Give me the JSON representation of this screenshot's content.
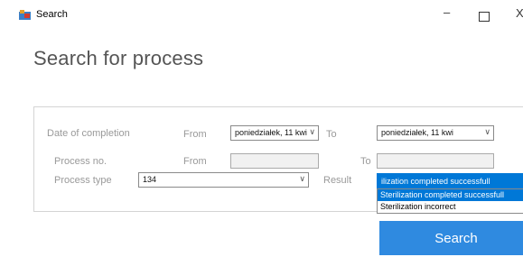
{
  "window": {
    "title": "Search"
  },
  "heading": "Search for process",
  "filters": {
    "date_of_completion_label": "Date of completion",
    "date_from_label": "From",
    "date_from_value": "poniedziałek, 11  kwi",
    "date_to_label": "To",
    "date_to_value": "poniedziałek, 11  kwi",
    "process_no_label": "Process no.",
    "process_from_label": "From",
    "process_from_value": "",
    "process_to_label": "To",
    "process_to_value": "",
    "process_type_label": "Process type",
    "process_type_value": "134",
    "result_label": "Result",
    "result_value": "ilization completed successfull",
    "result_options": [
      "Sterilization completed successfull",
      "Sterilization incorrect"
    ]
  },
  "search_button": "Search"
}
